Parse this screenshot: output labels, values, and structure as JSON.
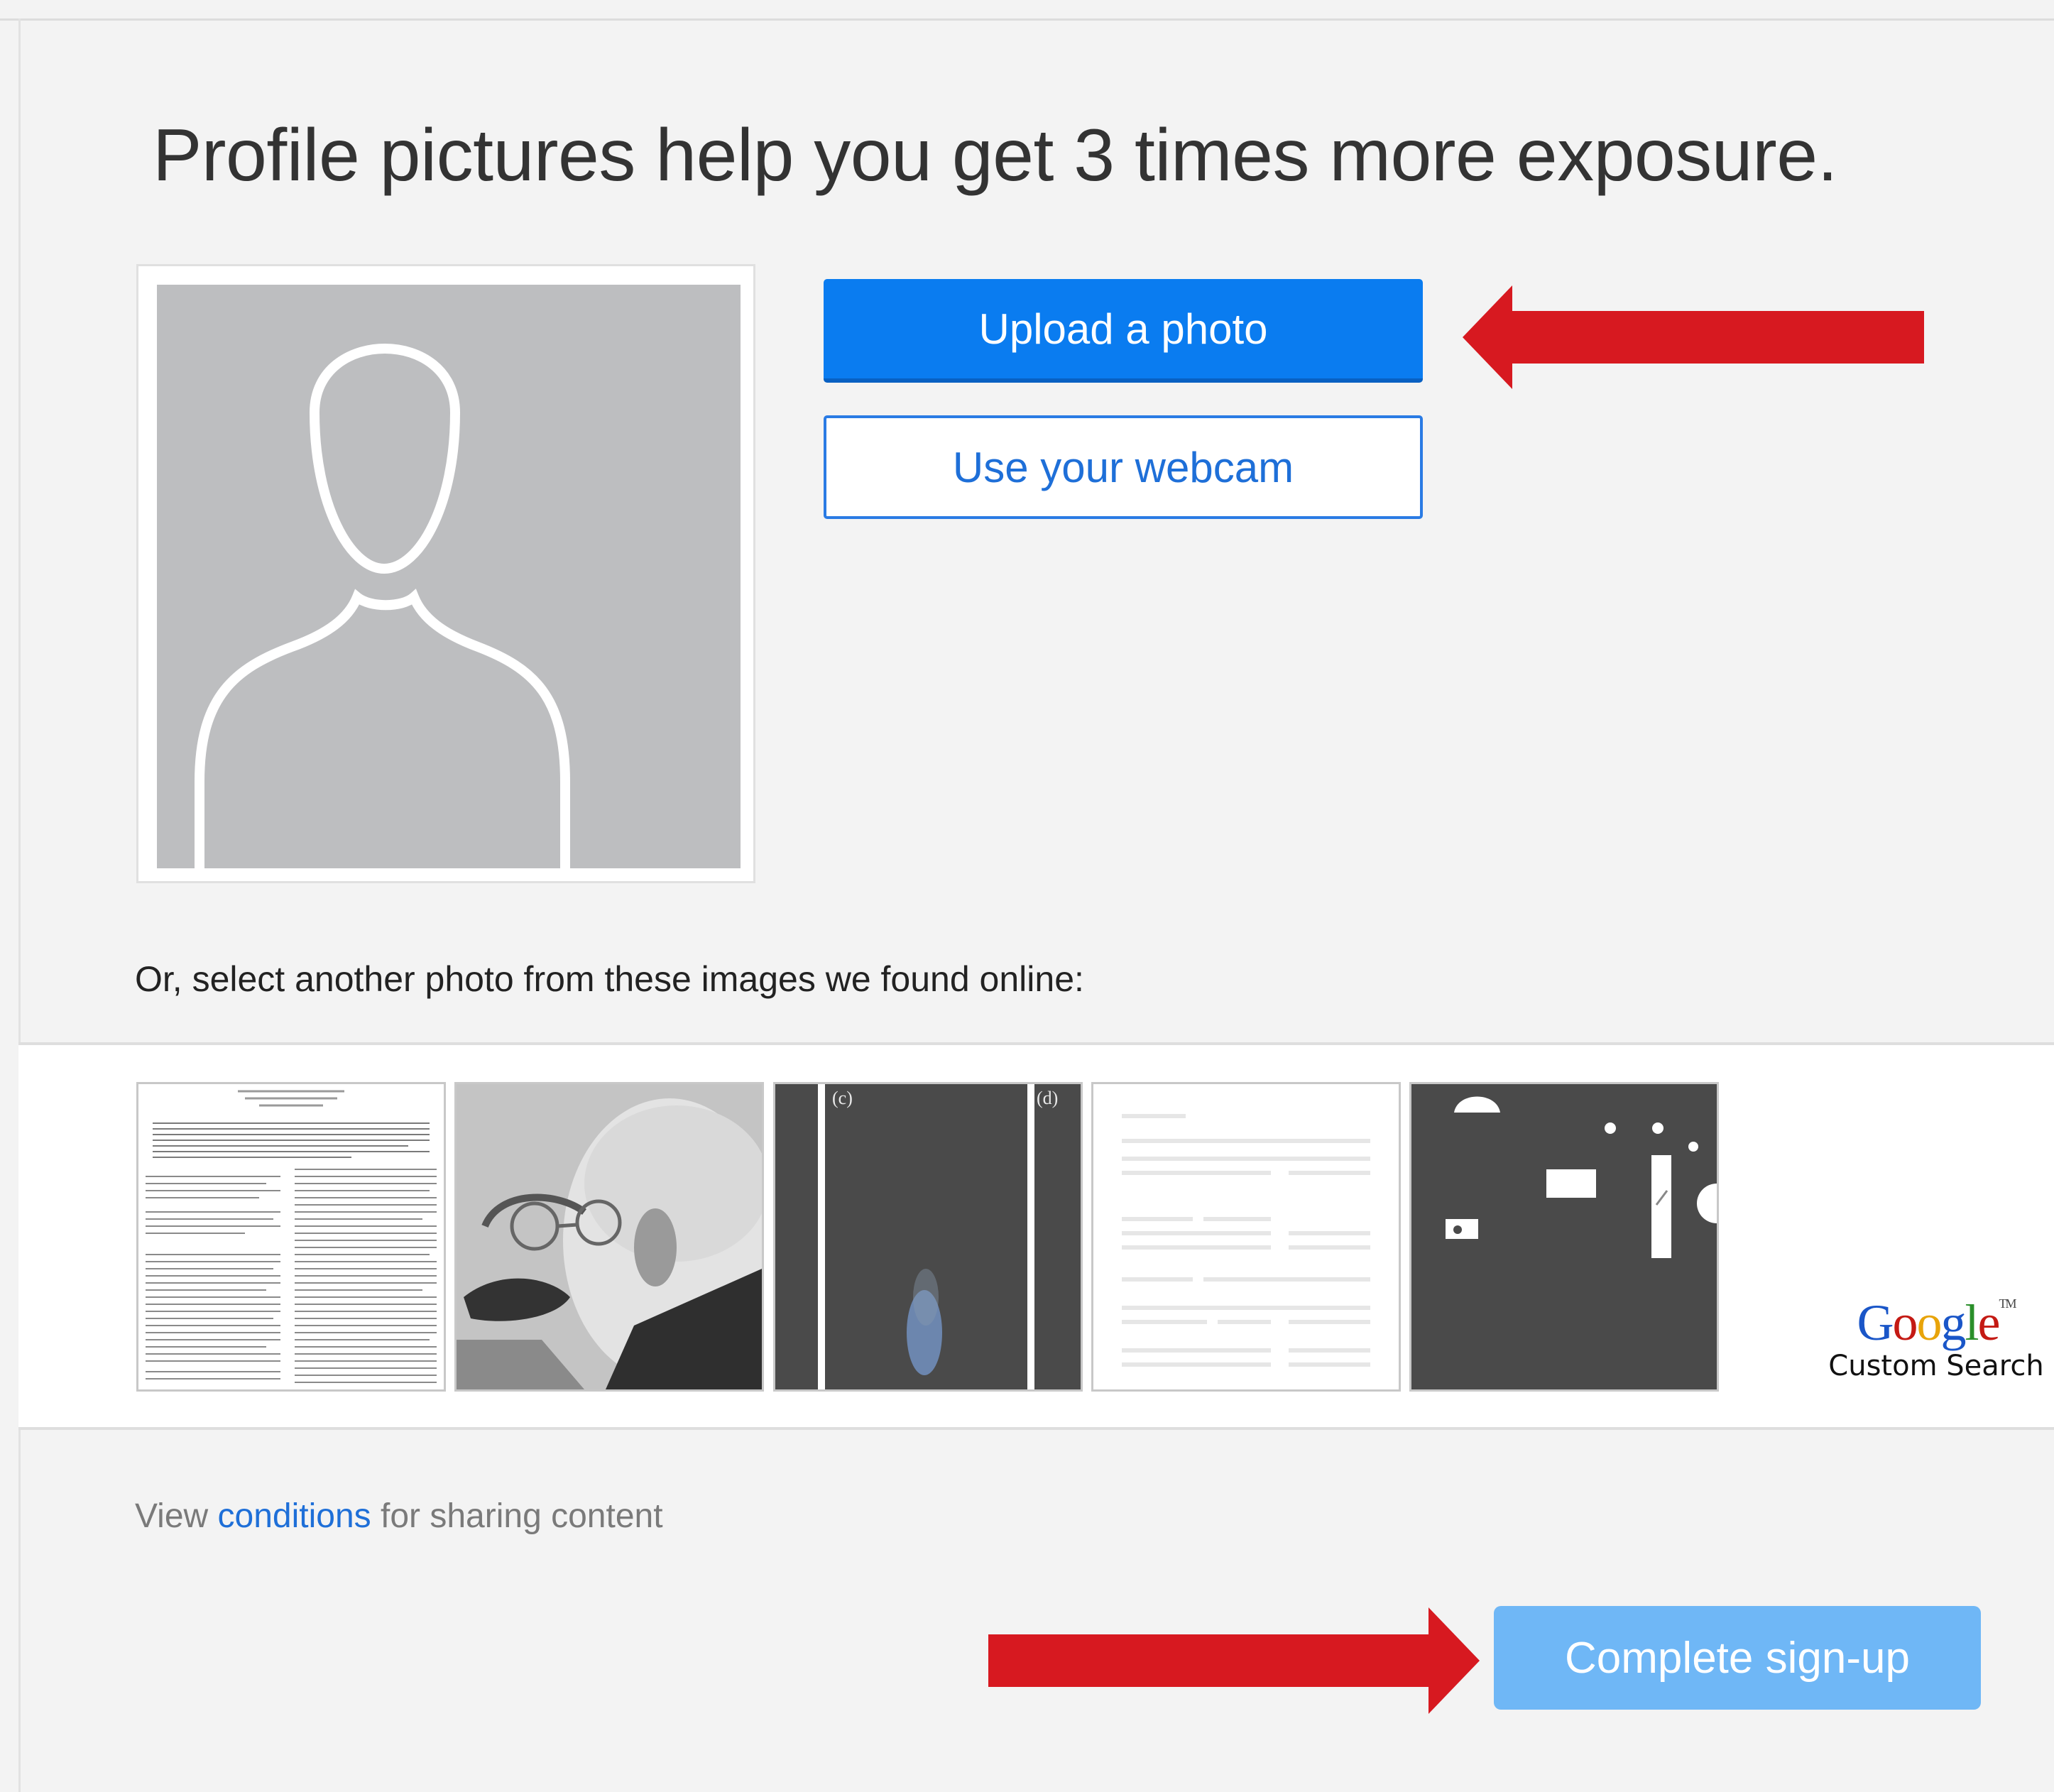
{
  "headline": "Profile pictures help you get 3 times more exposure.",
  "buttons": {
    "upload_label": "Upload a photo",
    "webcam_label": "Use your webcam",
    "complete_label": "Complete sign-up"
  },
  "select_prompt": "Or, select another photo from these images we found online:",
  "thumbnails": [
    {
      "description_icon": "document-page-thumbnail"
    },
    {
      "description_icon": "portrait-photo-thumbnail"
    },
    {
      "description_icon": "dark-panels-thumbnail",
      "labels": [
        "(c)",
        "(d)"
      ]
    },
    {
      "description_icon": "blank-form-thumbnail"
    },
    {
      "description_icon": "dark-diagram-thumbnail"
    }
  ],
  "google_badge": {
    "logo": [
      "G",
      "o",
      "o",
      "g",
      "l",
      "e"
    ],
    "tm": "TM",
    "custom_search": "Custom Search"
  },
  "footer": {
    "prefix": "View ",
    "link": "conditions",
    "suffix": " for sharing content"
  },
  "colors": {
    "page_background": "#f3f3f3",
    "upload_button": "#0a7cf0",
    "webcam_border": "#2a7be4",
    "complete_button": "#6fb7f6",
    "annotation_arrow": "#d71920",
    "link": "#1e6fd8"
  }
}
